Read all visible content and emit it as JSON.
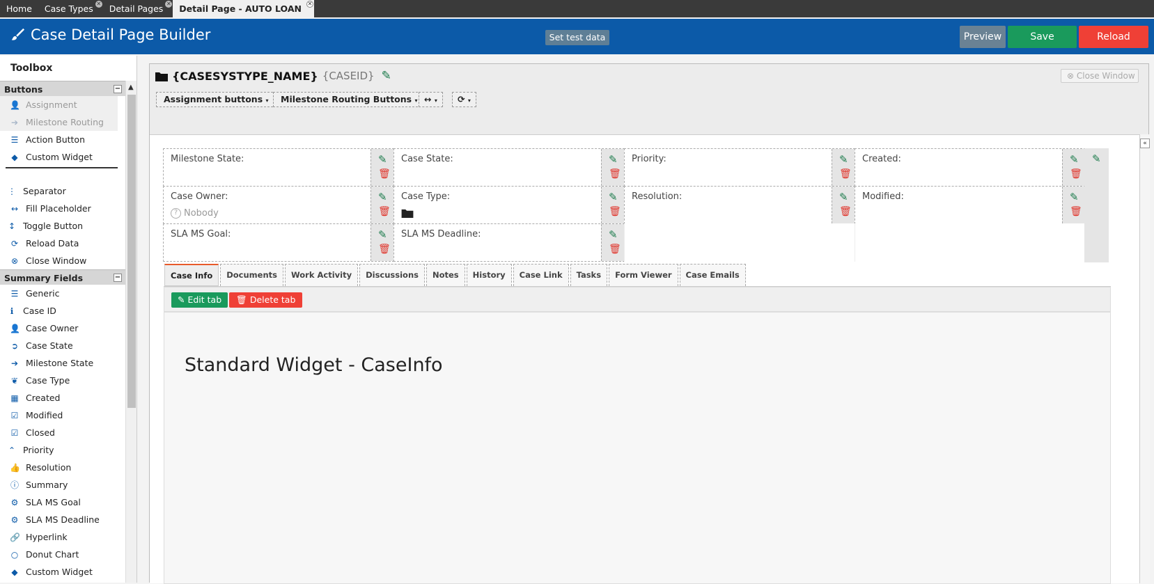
{
  "tabstrip": {
    "tabs": [
      {
        "label": "Home",
        "closable": false
      },
      {
        "label": "Case Types",
        "closable": true
      },
      {
        "label": "Detail Pages",
        "closable": true
      },
      {
        "label": "Detail Page - AUTO LOAN",
        "closable": true,
        "active": true
      }
    ]
  },
  "header": {
    "title": "Case Detail Page Builder",
    "set_test_data": "Set test data",
    "preview": "Preview",
    "save": "Save",
    "reload": "Reload"
  },
  "toolbox": {
    "title": "Toolbox",
    "sections": [
      {
        "name": "Buttons",
        "items": [
          {
            "label": "Assignment",
            "icon": "user-icon",
            "disabled": true
          },
          {
            "label": "Milestone Routing",
            "icon": "arrow-right-icon",
            "disabled": true
          },
          {
            "label": "Action Button",
            "icon": "database-icon"
          },
          {
            "label": "Custom Widget",
            "icon": "tag-icon"
          },
          {
            "label": "Separator",
            "icon": "separator-icon"
          },
          {
            "label": "Fill Placeholder",
            "icon": "arrows-horizontal-icon"
          },
          {
            "label": "Toggle Button",
            "icon": "arrows-vertical-icon"
          },
          {
            "label": "Reload Data",
            "icon": "refresh-icon"
          },
          {
            "label": "Close Window",
            "icon": "close-circle-icon"
          }
        ]
      },
      {
        "name": "Summary Fields",
        "items": [
          {
            "label": "Generic",
            "icon": "database-icon"
          },
          {
            "label": "Case ID",
            "icon": "info-icon"
          },
          {
            "label": "Case Owner",
            "icon": "user-icon"
          },
          {
            "label": "Case State",
            "icon": "arrow-circle-icon"
          },
          {
            "label": "Milestone State",
            "icon": "arrow-right-icon"
          },
          {
            "label": "Case Type",
            "icon": "leaf-icon"
          },
          {
            "label": "Created",
            "icon": "calendar-icon"
          },
          {
            "label": "Modified",
            "icon": "calendar-check-icon"
          },
          {
            "label": "Closed",
            "icon": "calendar-check-icon"
          },
          {
            "label": "Priority",
            "icon": "chevron-up-icon"
          },
          {
            "label": "Resolution",
            "icon": "thumbs-up-icon"
          },
          {
            "label": "Summary",
            "icon": "info-circle-icon"
          },
          {
            "label": "SLA MS Goal",
            "icon": "gear-icon"
          },
          {
            "label": "SLA MS Deadline",
            "icon": "gear-icon"
          },
          {
            "label": "Hyperlink",
            "icon": "link-icon"
          },
          {
            "label": "Donut Chart",
            "icon": "circle-icon"
          },
          {
            "label": "Custom Widget",
            "icon": "tag-icon"
          }
        ]
      }
    ]
  },
  "designer": {
    "title_name": "{CASESYSTYPE_NAME}",
    "title_id": "{CASEID}",
    "close_window": "Close Window",
    "toolbar": {
      "assignment_buttons": "Assignment buttons",
      "milestone_routing_buttons": "Milestone Routing Buttons"
    },
    "fields": [
      {
        "label": "Milestone State:",
        "value": ""
      },
      {
        "label": "Case State:",
        "value": ""
      },
      {
        "label": "Priority:",
        "value": ""
      },
      {
        "label": "Created:",
        "value": ""
      },
      {
        "label": "Case Owner:",
        "value": "Nobody"
      },
      {
        "label": "Case Type:",
        "value": ""
      },
      {
        "label": "Resolution:",
        "value": ""
      },
      {
        "label": "Modified:",
        "value": ""
      },
      {
        "label": "SLA MS Goal:",
        "value": ""
      },
      {
        "label": "SLA MS Deadline:",
        "value": ""
      }
    ],
    "tabs": [
      "Case Info",
      "Documents",
      "Work Activity",
      "Discussions",
      "Notes",
      "History",
      "Case Link",
      "Tasks",
      "Form Viewer",
      "Case Emails"
    ],
    "active_tab": "Case Info",
    "edit_tab": "Edit tab",
    "delete_tab": "Delete tab",
    "widget_title": "Standard Widget - CaseInfo"
  },
  "colors": {
    "header_bg": "#0c5aa8",
    "save": "#1a9a5c",
    "reload": "#ef4036",
    "preview": "#6a8294"
  }
}
